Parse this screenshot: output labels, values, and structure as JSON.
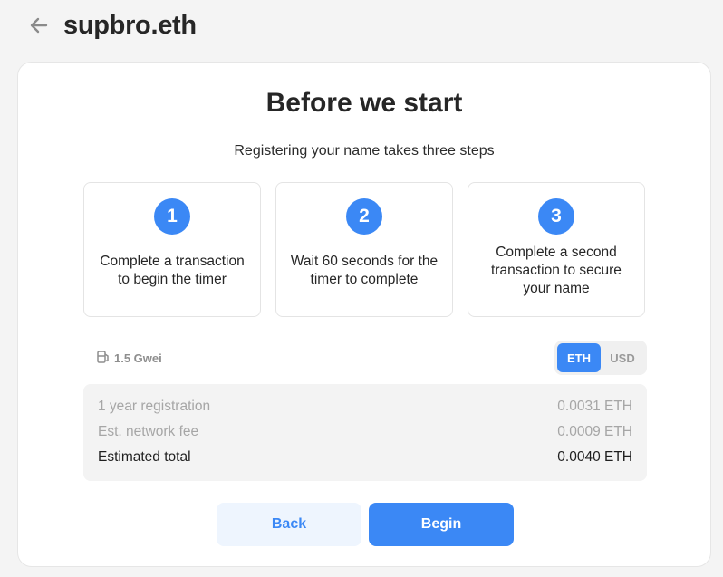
{
  "header": {
    "title": "supbro.eth"
  },
  "card": {
    "title": "Before we start",
    "subtitle": "Registering your name takes three steps"
  },
  "steps": [
    {
      "number": "1",
      "text": "Complete a transaction to begin the timer"
    },
    {
      "number": "2",
      "text": "Wait 60 seconds for the timer to complete"
    },
    {
      "number": "3",
      "text": "Complete a second transaction to secure your name"
    }
  ],
  "gas": {
    "value": "1.5 Gwei",
    "icon": "gas-pump-icon"
  },
  "currency_toggle": {
    "options": [
      "ETH",
      "USD"
    ],
    "selected": "ETH"
  },
  "fees": [
    {
      "label": "1 year registration",
      "value": "0.0031 ETH"
    },
    {
      "label": "Est. network fee",
      "value": "0.0009 ETH"
    },
    {
      "label": "Estimated total",
      "value": "0.0040 ETH"
    }
  ],
  "actions": {
    "back_label": "Back",
    "begin_label": "Begin"
  },
  "colors": {
    "accent": "#3b88f5",
    "accent_light": "#eef5fe",
    "muted_text": "#a6a6a6"
  }
}
